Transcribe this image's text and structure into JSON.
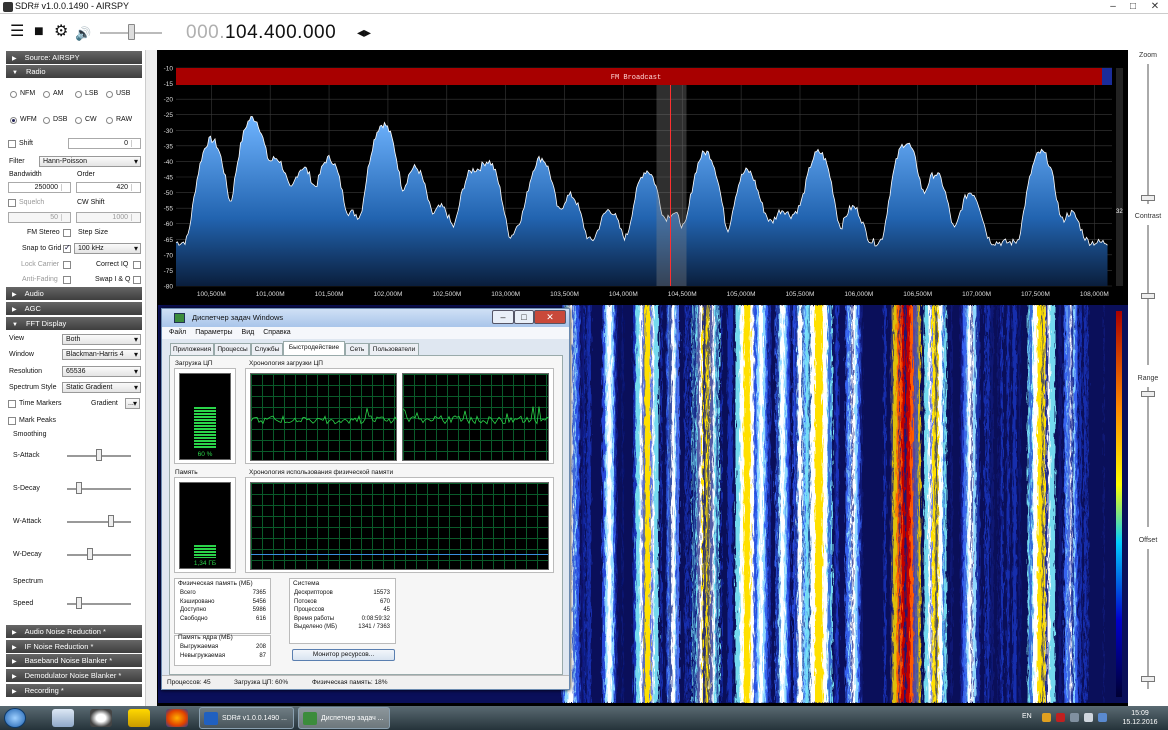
{
  "window": {
    "title": "SDR# v1.0.0.1490 - AIRSPY",
    "min": "–",
    "max": "□",
    "close": "✕"
  },
  "toolbar": {
    "menu_icon": "☰",
    "stop_icon": "■",
    "gear_icon": "⚙",
    "speaker_icon": "🔊",
    "freq_dim": "000.",
    "freq_main": "104.400.000",
    "freq_arrows": "◂▸",
    "volume": 0.45
  },
  "left": {
    "source": "Source: AIRSPY",
    "radio": "Radio",
    "modes": [
      "NFM",
      "AM",
      "LSB",
      "USB",
      "WFM",
      "DSB",
      "CW",
      "RAW"
    ],
    "mode_selected": "WFM",
    "shift_label": "Shift",
    "shift_value": "0",
    "filter_label": "Filter",
    "filter_value": "Hann-Poisson",
    "bandwidth_label": "Bandwidth",
    "bandwidth_value": "250000",
    "order_label": "Order",
    "order_value": "420",
    "squelch_label": "Squelch",
    "squelch_value": "50",
    "cwshift_label": "CW Shift",
    "cwshift_value": "1000",
    "fmstereo_label": "FM Stereo",
    "stepsize_label": "Step Size",
    "snap_label": "Snap to Grid",
    "snap_value": "100 kHz",
    "lockcarrier_label": "Lock Carrier",
    "correctiq_label": "Correct IQ",
    "antifading_label": "Anti-Fading",
    "swapiq_label": "Swap I & Q",
    "audio": "Audio",
    "agc": "AGC",
    "fft": "FFT Display",
    "view_label": "View",
    "view_value": "Both",
    "window_label": "Window",
    "window_value": "Blackman-Harris 4",
    "resolution_label": "Resolution",
    "resolution_value": "65536",
    "spectrum_style_label": "Spectrum Style",
    "spectrum_style_value": "Static Gradient",
    "time_markers_label": "Time Markers",
    "gradient_label": "Gradient",
    "gradient_btn": "...",
    "mark_peaks_label": "Mark Peaks",
    "smoothing_label": "Smoothing",
    "sattack_label": "S-Attack",
    "sdecay_label": "S-Decay",
    "wattack_label": "W-Attack",
    "wdecay_label": "W-Decay",
    "sattack": 0.5,
    "sdecay": 0.15,
    "wattack": 0.7,
    "wdecay": 0.35,
    "spectrum_label": "Spectrum",
    "speed_label": "Speed",
    "speed": 0.15,
    "audio_nr": "Audio Noise Reduction *",
    "if_nr": "IF Noise Reduction *",
    "baseband_nb": "Baseband Noise Blanker *",
    "demod_nb": "Demodulator Noise Blanker *",
    "recording": "Recording *"
  },
  "right": {
    "zoom_label": "Zoom",
    "contrast_label": "Contrast",
    "range_label": "Range",
    "offset_label": "Offset",
    "range_value": "32"
  },
  "spectrum": {
    "band_label": "FM Broadcast",
    "y_ticks": [
      "-10",
      "-15",
      "-20",
      "-25",
      "-30",
      "-35",
      "-40",
      "-45",
      "-50",
      "-55",
      "-60",
      "-65",
      "-70",
      "-75",
      "-80"
    ],
    "x_ticks": [
      "100,500M",
      "101,000M",
      "101,500M",
      "102,000M",
      "102,500M",
      "103,000M",
      "103,500M",
      "104,000M",
      "104,500M",
      "105,000M",
      "105,500M",
      "106,000M",
      "106,500M",
      "107,000M",
      "107,500M",
      "108,000M"
    ],
    "floor_db": -66,
    "peaks": [
      [
        100.5,
        -33
      ],
      [
        100.85,
        -26
      ],
      [
        101.05,
        -39
      ],
      [
        101.28,
        -42
      ],
      [
        101.5,
        -39
      ],
      [
        101.7,
        -57
      ],
      [
        101.96,
        -28
      ],
      [
        102.23,
        -42
      ],
      [
        102.45,
        -55
      ],
      [
        102.72,
        -43
      ],
      [
        102.85,
        -40
      ],
      [
        103.15,
        -60
      ],
      [
        103.3,
        -39
      ],
      [
        103.55,
        -51
      ],
      [
        103.88,
        -56
      ],
      [
        104.2,
        -43
      ],
      [
        104.42,
        -57
      ],
      [
        104.7,
        -37
      ],
      [
        105.05,
        -43
      ],
      [
        105.17,
        -57
      ],
      [
        105.35,
        -56
      ],
      [
        105.5,
        -56
      ],
      [
        105.66,
        -37
      ],
      [
        105.95,
        -55
      ],
      [
        106.4,
        -34
      ],
      [
        106.65,
        -44
      ],
      [
        106.95,
        -50
      ],
      [
        107.55,
        -37
      ],
      [
        107.8,
        -57
      ]
    ]
  },
  "taskmgr": {
    "title": "Диспетчер задач Windows",
    "menu": [
      "Файл",
      "Параметры",
      "Вид",
      "Справка"
    ],
    "tabs": [
      "Приложения",
      "Процессы",
      "Службы",
      "Быстродействие",
      "Сеть",
      "Пользователи"
    ],
    "active_tab": "Быстродействие",
    "cpu_label": "Загрузка ЦП",
    "cpu_value": "60 %",
    "cpu_level": 0.6,
    "cpu_hist_label": "Хронология загрузки ЦП",
    "mem_label": "Память",
    "mem_value": "1,34 ГБ",
    "mem_level": 0.18,
    "mem_hist_label": "Хронология использования физической памяти",
    "phys_title": "Физическая память (МБ)",
    "phys": [
      [
        "Всего",
        "7365"
      ],
      [
        "Кэшировано",
        "5456"
      ],
      [
        "Доступно",
        "5986"
      ],
      [
        "Свободно",
        "616"
      ]
    ],
    "kernel_title": "Память ядра (МБ)",
    "kernel": [
      [
        "Выгружаемая",
        "208"
      ],
      [
        "Невыгружаемая",
        "87"
      ]
    ],
    "system_title": "Система",
    "system": [
      [
        "Дескрипторов",
        "15573"
      ],
      [
        "Потоков",
        "670"
      ],
      [
        "Процессов",
        "45"
      ],
      [
        "Время работы",
        "0:08:59:32"
      ],
      [
        "Выделено (МБ)",
        "1341 / 7363"
      ]
    ],
    "resmon_button": "Монитор ресурсов...",
    "status_procs": "Процессов: 45",
    "status_cpu": "Загрузка ЦП: 60%",
    "status_mem": "Физическая память: 18%"
  },
  "taskbar": {
    "tasks": [
      "SDR# v1.0.0.1490 ...",
      "Диспетчер задач ..."
    ],
    "lang": "EN",
    "time": "15:09",
    "date": "15.12.2016"
  },
  "colors": {
    "section": "#4a4a4a",
    "accent": "#1b5fae",
    "band": "#b30000",
    "spectrum_fill": "#2b78c8"
  }
}
